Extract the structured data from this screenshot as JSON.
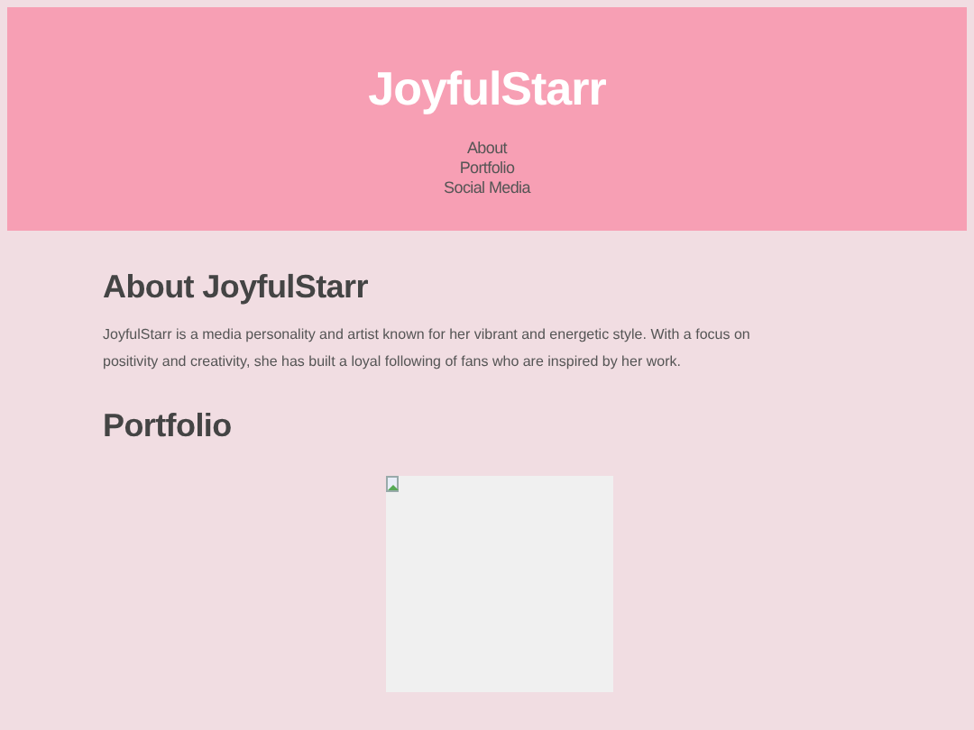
{
  "header": {
    "title": "JoyfulStarr",
    "nav": [
      "About",
      "Portfolio",
      "Social Media"
    ]
  },
  "sections": [
    {
      "heading": "About JoyfulStarr",
      "text": "JoyfulStarr is a media personality and artist known for her vibrant and energetic style. With a focus on positivity and creativity, she has built a loyal following of fans who are inspired by her work."
    },
    {
      "heading": "Portfolio",
      "image": {
        "kind": "broken-image"
      }
    }
  ]
}
